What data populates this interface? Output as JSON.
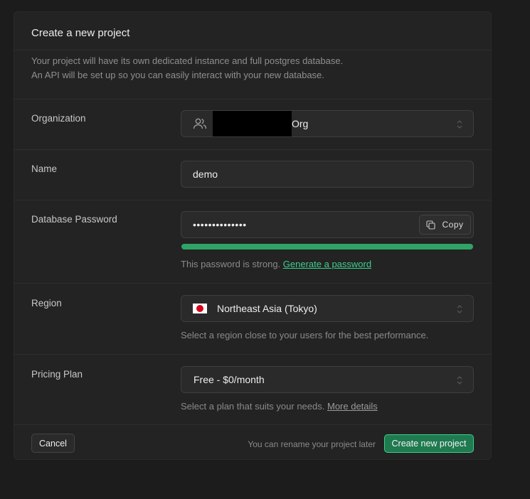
{
  "header": {
    "title": "Create a new project",
    "description_line1": "Your project will have its own dedicated instance and full postgres database.",
    "description_line2": "An API will be set up so you can easily interact with your new database."
  },
  "organization": {
    "label": "Organization",
    "value_suffix": "Org",
    "icon": "users-icon"
  },
  "name": {
    "label": "Name",
    "value": "demo"
  },
  "password": {
    "label": "Database Password",
    "masked_value": "••••••••••••••",
    "copy_label": "Copy",
    "strength_fraction": 1.0,
    "strength_text": "This password is strong.",
    "generate_link": "Generate a password"
  },
  "region": {
    "label": "Region",
    "value": "Northeast Asia (Tokyo)",
    "hint": "Select a region close to your users for the best performance."
  },
  "pricing": {
    "label": "Pricing Plan",
    "value": "Free - $0/month",
    "hint": "Select a plan that suits your needs.",
    "details_link": "More details"
  },
  "footer": {
    "cancel_label": "Cancel",
    "note": "You can rename your project later",
    "create_label": "Create new project"
  },
  "colors": {
    "accent": "#3ecf8e",
    "strength_bar": "#2fa466",
    "primary_button": "#1f7a4f"
  }
}
